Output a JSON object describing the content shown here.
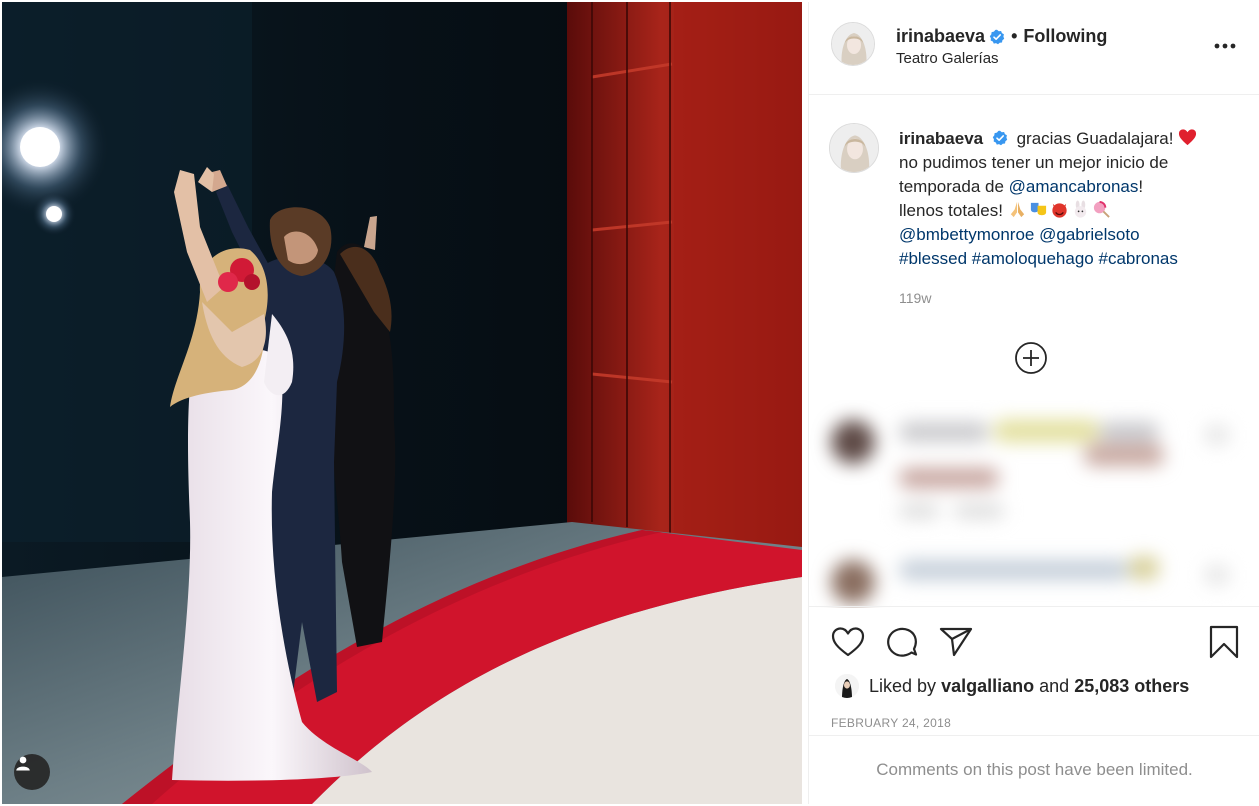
{
  "post": {
    "username": "irinabaeva",
    "following_label": "Following",
    "location": "Teatro Galerías",
    "caption": {
      "username": "irinabaeva",
      "text_1": "gracias Guadalajara!",
      "text_2": "no pudimos tener un mejor inicio de temporada de",
      "mention_1": "@amancabronas",
      "text_3": "!",
      "text_4": "llenos totales!",
      "mention_2": "@bmbettymonroe",
      "mention_3": "@gabrielsoto",
      "hashtag_1": "#blessed",
      "hashtag_2": "#amoloquehago",
      "hashtag_3": "#cabronas"
    },
    "age": "119w",
    "likes": {
      "prefix": "Liked by",
      "user": "valgalliano",
      "middle": "and",
      "count": "25,083 others"
    },
    "date": "FEBRUARY 24, 2018",
    "comments_limited": "Comments on this post have been limited."
  },
  "icons": {
    "verified": "verified-badge-icon",
    "more": "more-options-icon",
    "load_more": "plus-circle-icon",
    "like": "heart-icon",
    "comment": "comment-icon",
    "share": "paper-plane-icon",
    "save": "bookmark-icon",
    "tag": "user-tag-icon"
  },
  "colors": {
    "link": "#00376b",
    "verified": "#3897f0",
    "secondary_text": "#8e8e8e",
    "carpet_red": "#c8102e"
  }
}
